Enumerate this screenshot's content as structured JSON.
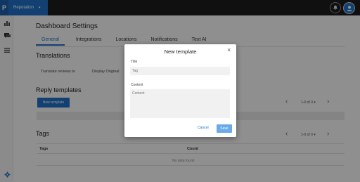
{
  "topbar": {
    "logo": "P",
    "app_name": "Reputation",
    "app_caret": "▾"
  },
  "page": {
    "title": "Dashboard Settings",
    "tabs": [
      "General",
      "Integrations",
      "Locations",
      "Notifications",
      "Text AI"
    ],
    "translations": {
      "heading": "Translations",
      "label": "Translate reviews to",
      "display": "Display Original"
    },
    "reply_templates": {
      "heading": "Reply templates",
      "new_button": "New template",
      "pager": "1-0 of 0 ▾"
    },
    "tags": {
      "heading": "Tags",
      "pager": "1-0 of 0 ▾",
      "col_tags": "Tags",
      "col_count": "Count",
      "empty": "No data found"
    }
  },
  "modal": {
    "title": "New template",
    "close": "×",
    "title_label": "Title",
    "title_placeholder": "Tag",
    "content_label": "Content",
    "content_placeholder": "Content",
    "cancel": "Cancel",
    "save": "Save"
  },
  "colors": {
    "accent": "#1f6fc4",
    "save_disabled": "#6aaae8"
  },
  "icons": [
    "bell-icon",
    "user-avatar-icon",
    "bar-chart-icon",
    "chat-icon",
    "list-icon",
    "gear-icon",
    "chevron-left-icon",
    "chevron-right-icon",
    "close-icon"
  ]
}
